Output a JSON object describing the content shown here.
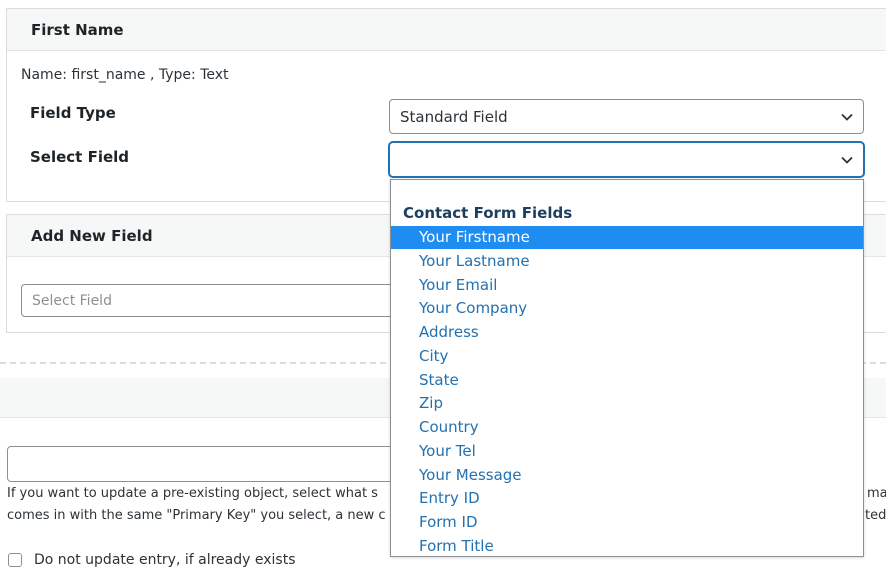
{
  "mapping_panel": {
    "title": "First Name",
    "meta": "Name: first_name , Type: Text",
    "field_type_label": "Field Type",
    "field_type_value": "Standard Field",
    "select_field_label": "Select Field",
    "select_field_value": ""
  },
  "add_panel": {
    "title": "Add New Field",
    "select_placeholder": "Select Field"
  },
  "dropdown": {
    "group_label": "Contact Form Fields",
    "options": [
      "Your Firstname",
      "Your Lastname",
      "Your Email",
      "Your Company",
      "Address",
      "City",
      "State",
      "Zip",
      "Country",
      "Your Tel",
      "Your Message",
      "Entry ID",
      "Form ID",
      "Form Title"
    ],
    "highlighted": "Your Firstname"
  },
  "primary_key": {
    "help_line1_left": "If you want to update a pre-existing object, select what s",
    "help_line1_right": "ma",
    "help_line2_left": "comes in with the same \"Primary Key\" you select, a new c",
    "help_line2_right": "ted.",
    "checkbox_label": "Do not update entry, if already exists"
  },
  "colors": {
    "accent": "#2271b1",
    "highlight": "#1e8cf0",
    "header_bg": "#f6f7f7"
  }
}
